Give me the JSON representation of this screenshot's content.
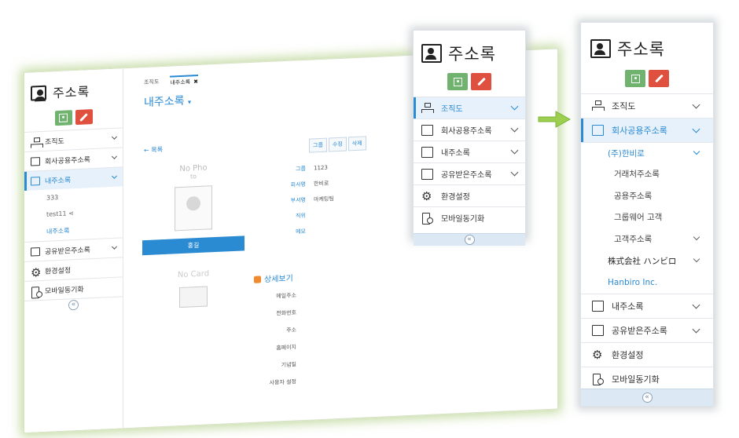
{
  "app_title": "주소록",
  "tilted": {
    "sidebar": {
      "items": [
        {
          "label": "조직도",
          "icon": "org-chart-icon"
        },
        {
          "label": "회사공용주소록",
          "icon": "company-book-icon"
        },
        {
          "label": "내주소록",
          "icon": "contact-book-icon",
          "active": true
        },
        {
          "label": "공유받은주소록",
          "icon": "shared-book-icon"
        },
        {
          "label": "환경설정",
          "icon": "gear-icon"
        },
        {
          "label": "모바일동기화",
          "icon": "mobile-sync-icon"
        }
      ],
      "subs": [
        "333",
        "test11",
        "내주소록"
      ]
    },
    "tabs": [
      "조직도",
      "내주소록"
    ],
    "page_title": "내주소록",
    "back_label": "목록",
    "tools": [
      "그룹",
      "수정",
      "삭제"
    ],
    "card": {
      "no_photo": "No Pho",
      "no_photo_sub": "to",
      "ribbon": "홍길",
      "no_card": "No Card"
    },
    "fields": [
      {
        "k": "그룹",
        "v": "1123"
      },
      {
        "k": "회사명",
        "v": "한비로"
      },
      {
        "k": "부서명",
        "v": "마케팅팀"
      },
      {
        "k": "직위",
        "v": ""
      },
      {
        "k": "메모",
        "v": ""
      }
    ],
    "section_title": "상세보기",
    "detail_labels": [
      "메일주소",
      "전화번호",
      "주소",
      "홈페이지",
      "기념일",
      "사용자 설정"
    ]
  },
  "mid": {
    "items": [
      {
        "label": "조직도",
        "active": true,
        "chevron": true
      },
      {
        "label": "회사공용주소록",
        "chevron": true
      },
      {
        "label": "내주소록",
        "chevron": true
      },
      {
        "label": "공유받은주소록",
        "chevron": true
      },
      {
        "label": "환경설정",
        "chevron": false
      },
      {
        "label": "모바일동기화",
        "chevron": false
      }
    ]
  },
  "right": {
    "items_top": [
      {
        "label": "조직도"
      },
      {
        "label": "회사공용주소록",
        "active": true
      }
    ],
    "company_group": "(주)한비로",
    "company_children": [
      {
        "label": "거래처주소록",
        "chevron": false
      },
      {
        "label": "공용주소록",
        "chevron": false
      },
      {
        "label": "그룹웨어 고객",
        "chevron": false
      },
      {
        "label": "고객주소록",
        "chevron": true
      }
    ],
    "other_groups": [
      {
        "label": "株式会社 ハンビロ",
        "chevron": true
      },
      {
        "label": "Hanbiro Inc.",
        "chevron": false
      }
    ],
    "items_bottom": [
      {
        "label": "내주소록",
        "chevron": true
      },
      {
        "label": "공유받은주소록",
        "chevron": true
      },
      {
        "label": "환경설정",
        "chevron": false
      },
      {
        "label": "모바일동기화",
        "chevron": false
      }
    ]
  },
  "collapse_glyph": "«",
  "colors": {
    "accent": "#2a8ad2",
    "green": "#6fb36f",
    "red": "#e0503f",
    "arrow": "#9ccf4f"
  }
}
